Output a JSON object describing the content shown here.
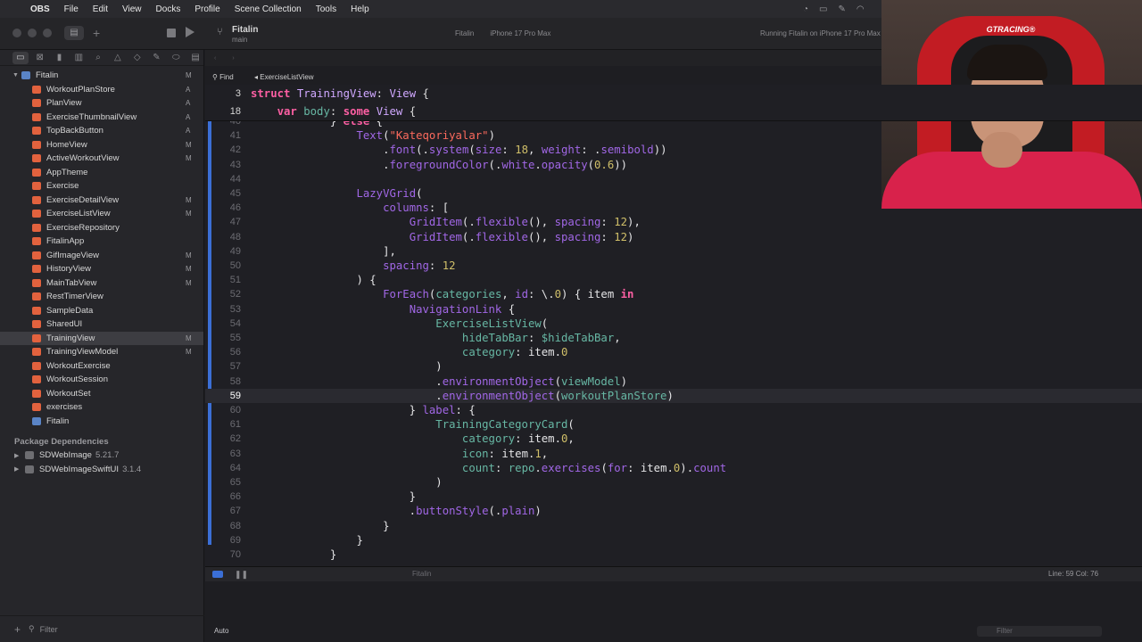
{
  "menubar": {
    "app": "OBS",
    "items": [
      "File",
      "Edit",
      "View",
      "Docks",
      "Profile",
      "Scene Collection",
      "Tools",
      "Help"
    ]
  },
  "toolbar": {
    "project": "Fitalin",
    "branch": "main",
    "scheme": "Fitalin",
    "destination": "iPhone 17 Pro Max",
    "run_status": "Running Fitalin on iPhone 17 Pro Max"
  },
  "sidebar": {
    "root": {
      "label": "Fitalin",
      "status": "M"
    },
    "items": [
      {
        "label": "WorkoutPlanStore",
        "status": "A"
      },
      {
        "label": "PlanView",
        "status": "A"
      },
      {
        "label": "ExerciseThumbnailView",
        "status": "A"
      },
      {
        "label": "TopBackButton",
        "status": "A"
      },
      {
        "label": "HomeView",
        "status": "M"
      },
      {
        "label": "ActiveWorkoutView",
        "status": "M"
      },
      {
        "label": "AppTheme",
        "status": ""
      },
      {
        "label": "Exercise",
        "status": ""
      },
      {
        "label": "ExerciseDetailView",
        "status": "M"
      },
      {
        "label": "ExerciseListView",
        "status": "M"
      },
      {
        "label": "ExerciseRepository",
        "status": ""
      },
      {
        "label": "FitalinApp",
        "status": ""
      },
      {
        "label": "GifImageView",
        "status": "M"
      },
      {
        "label": "HistoryView",
        "status": "M"
      },
      {
        "label": "MainTabView",
        "status": "M"
      },
      {
        "label": "RestTimerView",
        "status": ""
      },
      {
        "label": "SampleData",
        "status": ""
      },
      {
        "label": "SharedUI",
        "status": ""
      },
      {
        "label": "TrainingView",
        "status": "M"
      },
      {
        "label": "TrainingViewModel",
        "status": "M"
      },
      {
        "label": "WorkoutExercise",
        "status": ""
      },
      {
        "label": "WorkoutSession",
        "status": ""
      },
      {
        "label": "WorkoutSet",
        "status": ""
      },
      {
        "label": "exercises",
        "status": ""
      },
      {
        "label": "Fitalin",
        "status": ""
      }
    ],
    "selected_index": 18,
    "package_header": "Package Dependencies",
    "packages": [
      {
        "name": "SDWebImage",
        "version": "5.21.7"
      },
      {
        "name": "SDWebImageSwiftUI",
        "version": "3.1.4"
      }
    ],
    "filter_placeholder": "Filter"
  },
  "editor": {
    "find_label": "Find",
    "find_scope": "ExerciseListView",
    "sticky": [
      {
        "n": "3",
        "html": "<span class=\"kw\">struct</span> <span class=\"ty\">TrainingView</span>: <span class=\"ty\">View</span> {"
      },
      {
        "n": "18",
        "html": "    <span class=\"kw\">var</span> <span class=\"pr\">body</span>: <span class=\"kw\">some</span> <span class=\"ty\">View</span> {"
      }
    ],
    "current_line": "59",
    "lines": [
      {
        "n": "40",
        "html": "            } <span class=\"kw\">else</span> {"
      },
      {
        "n": "41",
        "html": "                <span class=\"fn\">Text</span>(<span class=\"st\">\"Kateqoriyalar\"</span>)"
      },
      {
        "n": "42",
        "html": "                    .<span class=\"fn\">font</span>(.<span class=\"fn\">system</span>(<span class=\"fn\">size</span>: <span class=\"nm\">18</span>, <span class=\"fn\">weight</span>: .<span class=\"fn\">semibold</span>))"
      },
      {
        "n": "43",
        "html": "                    .<span class=\"fn\">foregroundColor</span>(.<span class=\"fn\">white</span>.<span class=\"fn\">opacity</span>(<span class=\"nm\">0.6</span>))"
      },
      {
        "n": "44",
        "html": ""
      },
      {
        "n": "45",
        "html": "                <span class=\"fn\">LazyVGrid</span>("
      },
      {
        "n": "46",
        "html": "                    <span class=\"fn\">columns</span>: ["
      },
      {
        "n": "47",
        "html": "                        <span class=\"fn\">GridItem</span>(.<span class=\"fn\">flexible</span>(), <span class=\"fn\">spacing</span>: <span class=\"nm\">12</span>),"
      },
      {
        "n": "48",
        "html": "                        <span class=\"fn\">GridItem</span>(.<span class=\"fn\">flexible</span>(), <span class=\"fn\">spacing</span>: <span class=\"nm\">12</span>)"
      },
      {
        "n": "49",
        "html": "                    ],"
      },
      {
        "n": "50",
        "html": "                    <span class=\"fn\">spacing</span>: <span class=\"nm\">12</span>"
      },
      {
        "n": "51",
        "html": "                ) {"
      },
      {
        "n": "52",
        "html": "                    <span class=\"fn\">ForEach</span>(<span class=\"pr\">categories</span>, <span class=\"fn\">id</span>: \\.<span class=\"nm\">0</span>) { item <span class=\"kw\">in</span>"
      },
      {
        "n": "53",
        "html": "                        <span class=\"fn\">NavigationLink</span> {"
      },
      {
        "n": "54",
        "html": "                            <span class=\"pr\">ExerciseListView</span>("
      },
      {
        "n": "55",
        "html": "                                <span class=\"pr\">hideTabBar</span>: <span class=\"pr\">$hideTabBar</span>,"
      },
      {
        "n": "56",
        "html": "                                <span class=\"pr\">category</span>: item.<span class=\"nm\">0</span>"
      },
      {
        "n": "57",
        "html": "                            )"
      },
      {
        "n": "58",
        "html": "                            .<span class=\"fn\">environmentObject</span>(<span class=\"pr\">viewModel</span>)"
      },
      {
        "n": "59",
        "html": "                            .<span class=\"fn\">environmentObject</span>(<span class=\"pr\">workoutPlanStore</span>)"
      },
      {
        "n": "60",
        "html": "                        } <span class=\"fn\">label</span>: {"
      },
      {
        "n": "61",
        "html": "                            <span class=\"pr\">TrainingCategoryCard</span>("
      },
      {
        "n": "62",
        "html": "                                <span class=\"pr\">category</span>: item.<span class=\"nm\">0</span>,"
      },
      {
        "n": "63",
        "html": "                                <span class=\"pr\">icon</span>: item.<span class=\"nm\">1</span>,"
      },
      {
        "n": "64",
        "html": "                                <span class=\"pr\">count</span>: <span class=\"pr\">repo</span>.<span class=\"fn\">exercises</span>(<span class=\"fn\">for</span>: item.<span class=\"nm\">0</span>).<span class=\"fn\">count</span>"
      },
      {
        "n": "65",
        "html": "                            )"
      },
      {
        "n": "66",
        "html": "                        }"
      },
      {
        "n": "67",
        "html": "                        .<span class=\"fn\">buttonStyle</span>(.<span class=\"fn\">plain</span>)"
      },
      {
        "n": "68",
        "html": "                    }"
      },
      {
        "n": "69",
        "html": "                }"
      },
      {
        "n": "70",
        "html": "            }"
      }
    ]
  },
  "debug": {
    "target": "Fitalin",
    "cursor": "Line: 59  Col: 76"
  },
  "console": {
    "mode": "Auto",
    "filter_placeholder": "Filter"
  },
  "webcam": {
    "chair_logo": "GTRACING®"
  },
  "colors": {
    "keyword": "#fc5fa3",
    "type": "#d0a8ff",
    "string": "#fc6a5d",
    "number": "#d0bf69",
    "accent": "#3b6fd6"
  }
}
